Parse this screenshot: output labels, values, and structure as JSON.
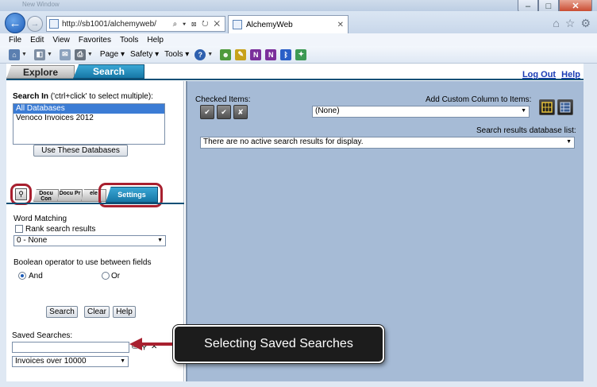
{
  "browser": {
    "title": "New Window",
    "url": "http://sb1001/alchemyweb/",
    "url_controls": "⌕ ▾ ⊠ ↻ ✕",
    "tab_title": "AlchemyWeb",
    "menu": [
      "File",
      "Edit",
      "View",
      "Favorites",
      "Tools",
      "Help"
    ],
    "cmd": {
      "page": "Page ▾",
      "safety": "Safety ▾",
      "tools": "Tools ▾"
    }
  },
  "app": {
    "tabs": {
      "explore": "Explore",
      "search": "Search"
    },
    "links": {
      "logout": "Log Out",
      "help": "Help"
    },
    "left": {
      "search_in_bold": "Search In",
      "search_in_hint": " ('ctrl+click' to select multiple):",
      "databases": [
        "All Databases",
        "Venoco Invoices 2012"
      ],
      "use_button": "Use These Databases",
      "subtabs": {
        "doc_con": "Docu Con",
        "doc_pr": "Docu Pr",
        "ele": "ele",
        "settings": "Settings"
      },
      "word_matching": "Word Matching",
      "rank_label": "Rank search results",
      "matching_value": "0 - None",
      "boolean_label": "Boolean operator to use between fields",
      "and_label": "And",
      "or_label": "Or",
      "btn_search": "Search",
      "btn_clear": "Clear",
      "btn_help": "Help",
      "saved_label": "Saved Searches:",
      "saved_value": "Invoices over 10000"
    },
    "right": {
      "checked_items": "Checked Items:",
      "add_column": "Add Custom Column to Items:",
      "column_value": "(None)",
      "results_list_label": "Search results database list:",
      "results_value": "There are no active search results for display."
    }
  },
  "callout": {
    "text": "Selecting Saved Searches"
  },
  "colors": {
    "accent": "#1677a6",
    "highlight": "#a8202f",
    "panel": "#a6bbd6"
  }
}
